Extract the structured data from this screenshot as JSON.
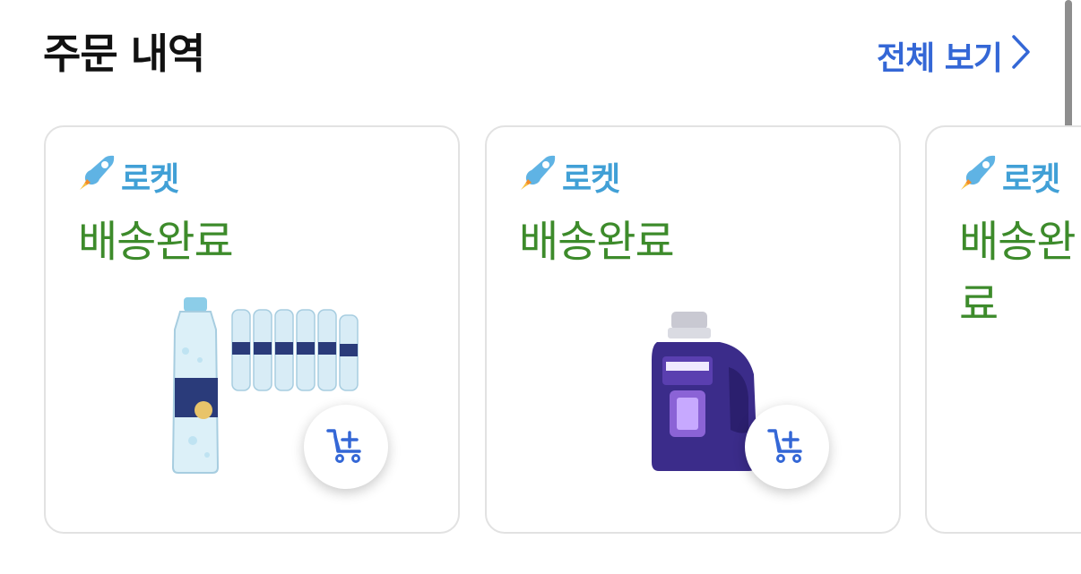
{
  "section": {
    "title": "주문 내역",
    "see_all_label": "전체 보기"
  },
  "orders": [
    {
      "badge": "로켓",
      "status": "배송완료",
      "product_icon": "water-bottle-pack",
      "cart_icon": "cart-plus-icon"
    },
    {
      "badge": "로켓",
      "status": "배송완료",
      "product_icon": "detergent-bottle",
      "cart_icon": "cart-plus-icon"
    },
    {
      "badge": "로켓",
      "status": "배송완료"
    }
  ],
  "colors": {
    "title": "#111111",
    "link": "#3467d6",
    "badge": "#41a0d6",
    "status": "#3d8b2b",
    "cart_icon": "#3467d6",
    "card_border": "#e2e2e2"
  }
}
